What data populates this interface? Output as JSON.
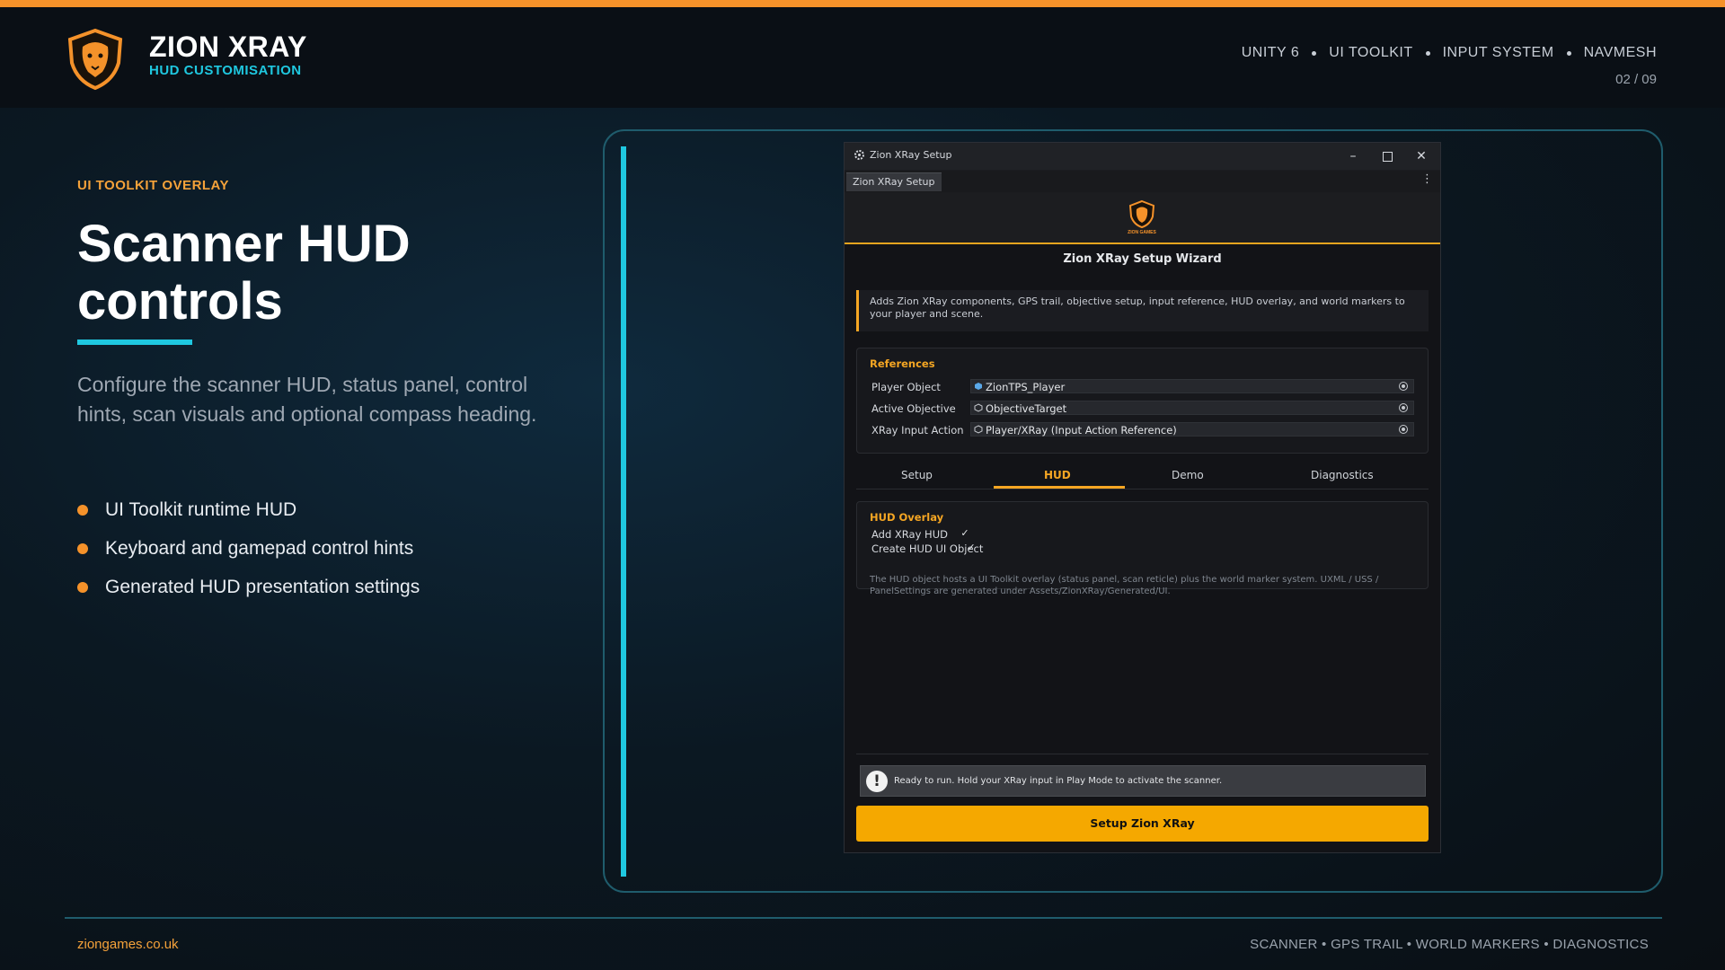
{
  "brand": {
    "title": "ZION XRAY",
    "subtitle": "HUD CUSTOMISATION"
  },
  "tech": [
    "UNITY 6",
    "UI TOOLKIT",
    "INPUT SYSTEM",
    "NAVMESH"
  ],
  "page_number": "02 / 09",
  "left": {
    "eyebrow": "UI TOOLKIT OVERLAY",
    "headline_line1": "Scanner HUD",
    "headline_line2": "controls",
    "lede": "Configure the scanner HUD, status panel, control hints, scan visuals and optional compass heading.",
    "bullets": [
      "UI Toolkit runtime HUD",
      "Keyboard and gamepad control hints",
      "Generated HUD presentation settings"
    ]
  },
  "window": {
    "title": "Zion XRay Setup",
    "tab": "Zion XRay Setup",
    "logo_text": "ZION GAMES",
    "wizard_title": "Zion XRay Setup Wizard",
    "info": "Adds Zion XRay components, GPS trail, objective setup, input reference, HUD overlay, and world markers to your player and scene.",
    "references": {
      "title": "References",
      "rows": [
        {
          "label": "Player Object",
          "value": "ZionTPS_Player"
        },
        {
          "label": "Active Objective",
          "value": "ObjectiveTarget"
        },
        {
          "label": "XRay Input Action",
          "value": "Player/XRay (Input Action Reference)"
        }
      ]
    },
    "tabs": [
      "Setup",
      "HUD",
      "Demo",
      "Diagnostics"
    ],
    "active_tab": "HUD",
    "hud": {
      "title": "HUD Overlay",
      "add_label": "Add XRay HUD",
      "add_checked": true,
      "create_label": "Create HUD UI Object",
      "create_checked": true,
      "note": "The HUD object hosts a UI Toolkit overlay (status panel, scan reticle) plus the world marker system. UXML / USS / PanelSettings are generated under Assets/ZionXRay/Generated/UI."
    },
    "status": "Ready to run. Hold your XRay input in Play Mode to activate the scanner.",
    "button": "Setup Zion XRay"
  },
  "footer": {
    "url": "ziongames.co.uk",
    "tags": "SCANNER • GPS TRAIL • WORLD MARKERS • DIAGNOSTICS"
  },
  "colors": {
    "accent_orange": "#f5922a",
    "accent_cyan": "#1fc8e0",
    "unity_gold": "#f5a800"
  }
}
